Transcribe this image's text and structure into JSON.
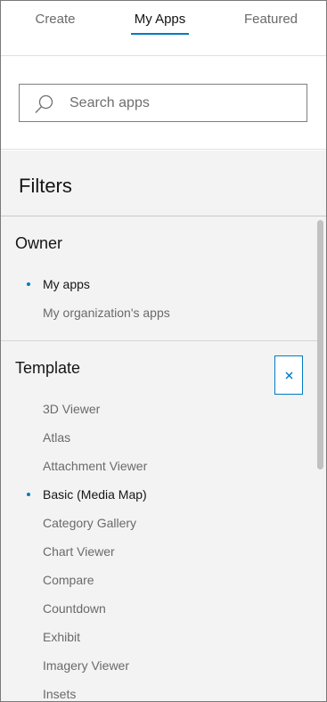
{
  "tabs": [
    {
      "label": "Create"
    },
    {
      "label": "My Apps"
    },
    {
      "label": "Featured"
    }
  ],
  "active_tab": "My Apps",
  "search": {
    "placeholder": "Search apps",
    "value": ""
  },
  "filters": {
    "title": "Filters",
    "owner": {
      "title": "Owner",
      "items": [
        {
          "label": "My apps",
          "selected": true
        },
        {
          "label": "My organization's apps",
          "selected": false
        }
      ]
    },
    "template": {
      "title": "Template",
      "items": [
        {
          "label": "3D Viewer",
          "selected": false
        },
        {
          "label": "Atlas",
          "selected": false
        },
        {
          "label": "Attachment Viewer",
          "selected": false
        },
        {
          "label": "Basic (Media Map)",
          "selected": true
        },
        {
          "label": "Category Gallery",
          "selected": false
        },
        {
          "label": "Chart Viewer",
          "selected": false
        },
        {
          "label": "Compare",
          "selected": false
        },
        {
          "label": "Countdown",
          "selected": false
        },
        {
          "label": "Exhibit",
          "selected": false
        },
        {
          "label": "Imagery Viewer",
          "selected": false
        },
        {
          "label": "Insets",
          "selected": false
        }
      ]
    }
  },
  "colors": {
    "accent": "#007ac2",
    "panel_bg": "#f3f3f3"
  }
}
